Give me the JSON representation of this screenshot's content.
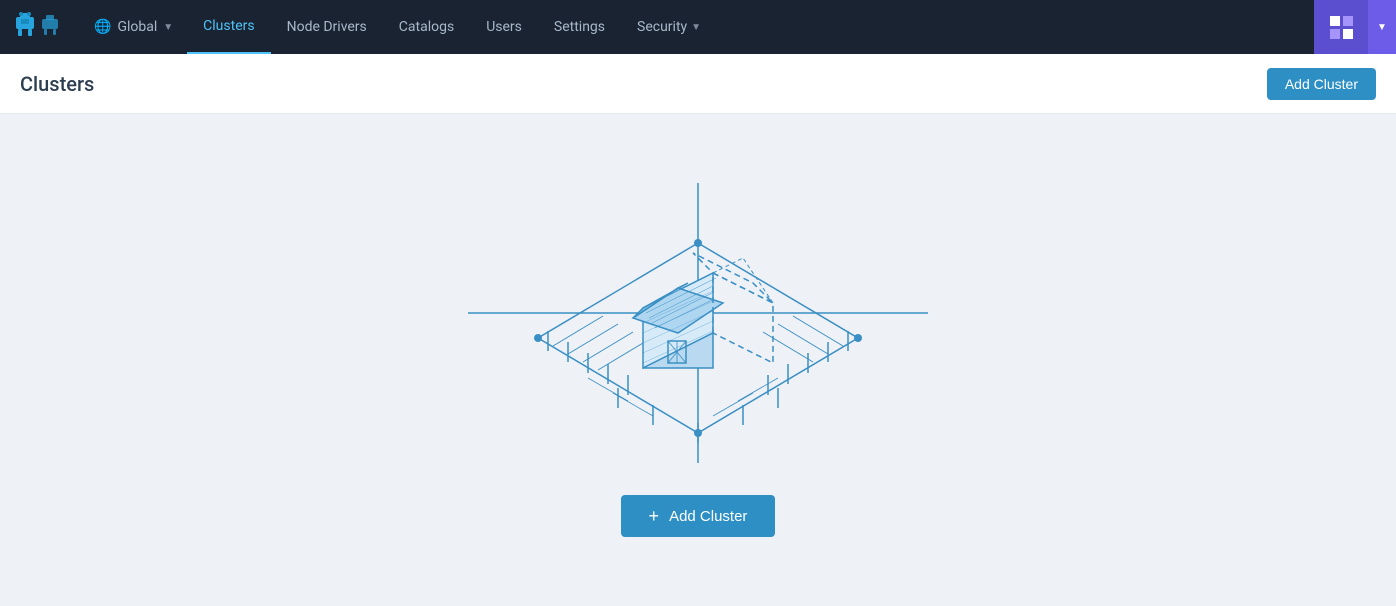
{
  "nav": {
    "logo_alt": "Rancher logo",
    "global_label": "Global",
    "items": [
      {
        "id": "clusters",
        "label": "Clusters",
        "active": true
      },
      {
        "id": "node-drivers",
        "label": "Node Drivers",
        "active": false
      },
      {
        "id": "catalogs",
        "label": "Catalogs",
        "active": false
      },
      {
        "id": "users",
        "label": "Users",
        "active": false
      },
      {
        "id": "settings",
        "label": "Settings",
        "active": false
      },
      {
        "id": "security",
        "label": "Security",
        "active": false,
        "hasDropdown": true
      }
    ]
  },
  "page": {
    "title": "Clusters",
    "add_cluster_label": "Add Cluster"
  },
  "empty_state": {
    "add_cluster_label": "Add Cluster",
    "plus_icon": "+"
  }
}
